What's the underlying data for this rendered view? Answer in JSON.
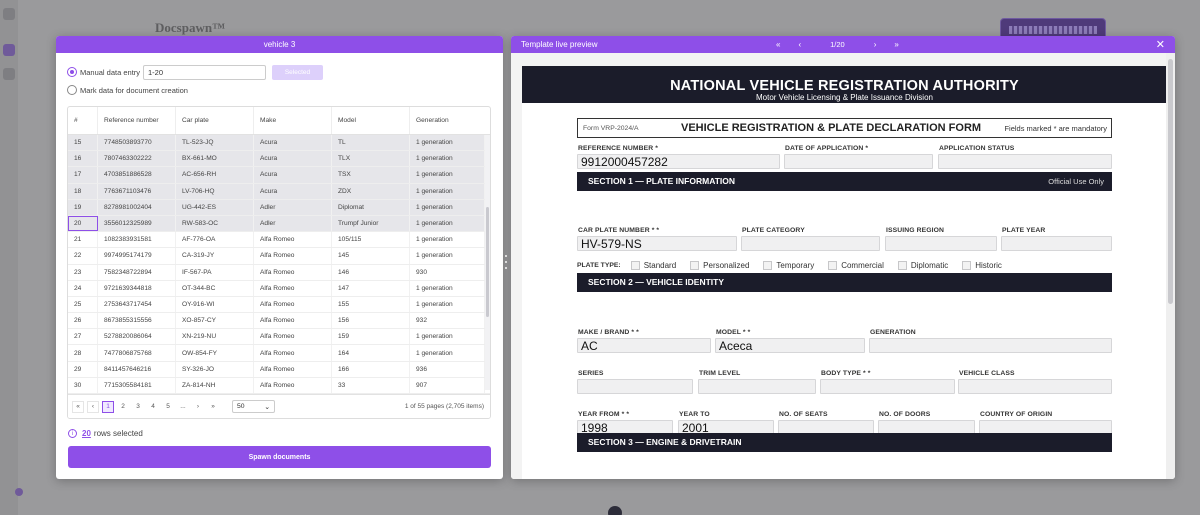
{
  "background": {
    "brand": "Docspawn™"
  },
  "left_panel": {
    "title": "vehicle 3",
    "manual_entry_label": "Manual data entry",
    "range_value": "1-20",
    "select_button": "Selected",
    "mark_data_label": "Mark data for document creation",
    "columns": [
      "#",
      "Reference number",
      "Car plate",
      "Make",
      "Model",
      "Generation"
    ],
    "rows": [
      [
        "15",
        "7748503893770",
        "TL-523-JQ",
        "Acura",
        "TL",
        "1 generation"
      ],
      [
        "16",
        "7807463302222",
        "BX-661-MO",
        "Acura",
        "TLX",
        "1 generation"
      ],
      [
        "17",
        "4703851886528",
        "AC-656-RH",
        "Acura",
        "TSX",
        "1 generation"
      ],
      [
        "18",
        "7763671103476",
        "LV-706-HQ",
        "Acura",
        "ZDX",
        "1 generation"
      ],
      [
        "19",
        "8278981002404",
        "UG-442-ES",
        "Adler",
        "Diplomat",
        "1 generation"
      ],
      [
        "20",
        "3556012325989",
        "RW-583-OC",
        "Adler",
        "Trumpf Junior",
        "1 generation"
      ],
      [
        "21",
        "1082383931581",
        "AF-776-OA",
        "Alfa Romeo",
        "105/115",
        "1 generation"
      ],
      [
        "22",
        "9974995174179",
        "CA-319-JY",
        "Alfa Romeo",
        "145",
        "1 generation"
      ],
      [
        "23",
        "7582348722894",
        "IF-567-PA",
        "Alfa Romeo",
        "146",
        "930"
      ],
      [
        "24",
        "9721639344818",
        "OT-344-BC",
        "Alfa Romeo",
        "147",
        "1 generation"
      ],
      [
        "25",
        "2753643717454",
        "OY-916-WI",
        "Alfa Romeo",
        "155",
        "1 generation"
      ],
      [
        "26",
        "8673855315556",
        "XO-857-CY",
        "Alfa Romeo",
        "156",
        "932"
      ],
      [
        "27",
        "5278820086064",
        "XN-219-NU",
        "Alfa Romeo",
        "159",
        "1 generation"
      ],
      [
        "28",
        "7477806875768",
        "OW-854-FY",
        "Alfa Romeo",
        "164",
        "1 generation"
      ],
      [
        "29",
        "8411457646216",
        "SY-326-JO",
        "Alfa Romeo",
        "166",
        "936"
      ],
      [
        "30",
        "7715305584181",
        "ZA-814-NH",
        "Alfa Romeo",
        "33",
        "907"
      ]
    ],
    "pager": {
      "first": "«",
      "prev": "‹",
      "pages": [
        "1",
        "2",
        "3",
        "4",
        "5",
        "..."
      ],
      "next": "›",
      "last": "»",
      "page_size": "50",
      "info": "1 of 55 pages (2,705 items)"
    },
    "rows_selected_count": "20",
    "rows_selected_text": "rows selected",
    "spawn_button": "Spawn documents"
  },
  "right_panel": {
    "title": "Template live preview",
    "nav_first": "«",
    "nav_prev": "‹",
    "page_indicator": "1/20",
    "nav_next": "›",
    "nav_last": "»",
    "close": "✕",
    "doc": {
      "authority": "NATIONAL VEHICLE REGISTRATION AUTHORITY",
      "subtitle": "Motor Vehicle Licensing & Plate Issuance Division",
      "form_id": "Form VRP-2024/A",
      "form_title": "VEHICLE REGISTRATION & PLATE DECLARATION FORM",
      "mandatory_note": "Fields marked * are mandatory",
      "reference_label": "REFERENCE NUMBER *",
      "reference_value": "9912000457282",
      "date_label": "DATE OF APPLICATION *",
      "status_label": "APPLICATION STATUS",
      "section1": "SECTION 1 — PLATE INFORMATION",
      "official_use": "Official Use Only",
      "plate_label": "CAR PLATE NUMBER * *",
      "plate_value": "HV-579-NS",
      "plate_category_label": "PLATE CATEGORY",
      "issuing_region_label": "ISSUING REGION",
      "plate_year_label": "PLATE YEAR",
      "plate_type_label": "PLATE TYPE:",
      "plate_types": [
        "Standard",
        "Personalized",
        "Temporary",
        "Commercial",
        "Diplomatic",
        "Historic"
      ],
      "section2": "SECTION 2 — VEHICLE IDENTITY",
      "make_label": "MAKE / BRAND * *",
      "make_value": "AC",
      "model_label": "MODEL * *",
      "model_value": "Aceca",
      "generation_label": "GENERATION",
      "series_label": "SERIES",
      "trim_label": "TRIM LEVEL",
      "body_label": "BODY TYPE * *",
      "class_label": "VEHICLE CLASS",
      "year_from_label": "YEAR FROM * *",
      "year_from_value": "1998",
      "year_to_label": "YEAR TO",
      "year_to_value": "2001",
      "seats_label": "NO. OF SEATS",
      "doors_label": "NO. OF DOORS",
      "origin_label": "COUNTRY OF ORIGIN",
      "section3": "SECTION 3 — ENGINE & DRIVETRAIN"
    }
  }
}
